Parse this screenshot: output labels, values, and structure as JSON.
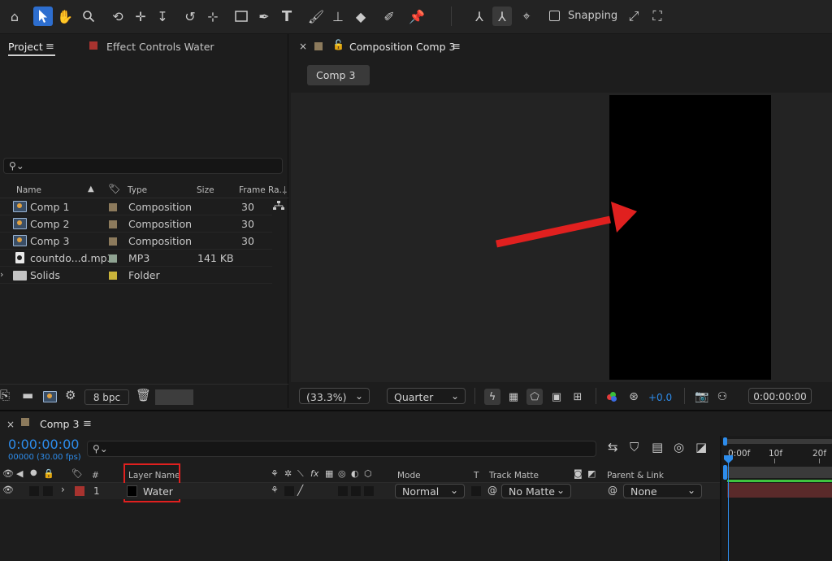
{
  "toolbar": {
    "tools": [
      "home-icon",
      "selection-arrow-icon",
      "hand-icon",
      "zoom-icon",
      "orbit-camera-icon",
      "pan-camera-icon",
      "dolly-camera-icon",
      "rotation-icon",
      "anchor-point-icon",
      "rectangle-icon",
      "pen-icon",
      "type-icon",
      "brush-icon",
      "clone-stamp-icon",
      "eraser-icon",
      "roto-brush-icon",
      "puppet-pin-icon"
    ],
    "snapping_label": "Snapping"
  },
  "project_panel": {
    "tab_project": "Project",
    "tab_effect_controls": "Effect Controls Water",
    "columns": {
      "name": "Name",
      "type": "Type",
      "size": "Size",
      "frame_rate": "Frame Ra..."
    },
    "items": [
      {
        "name": "Comp 1",
        "type": "Composition",
        "size": "",
        "frame_rate": "30",
        "label_color": "#8c7a5c",
        "icon": "composition-icon"
      },
      {
        "name": "Comp 2",
        "type": "Composition",
        "size": "",
        "frame_rate": "30",
        "label_color": "#8c7a5c",
        "icon": "composition-icon"
      },
      {
        "name": "Comp 3",
        "type": "Composition",
        "size": "",
        "frame_rate": "30",
        "label_color": "#8c7a5c",
        "icon": "composition-icon"
      },
      {
        "name": "countdo...d.mp3",
        "type": "MP3",
        "size": "141 KB",
        "frame_rate": "",
        "label_color": "#8fa392",
        "icon": "audio-file-icon"
      },
      {
        "name": "Solids",
        "type": "Folder",
        "size": "",
        "frame_rate": "",
        "label_color": "#c9b33a",
        "icon": "folder-icon"
      }
    ],
    "bpc_label": "8 bpc"
  },
  "comp_panel": {
    "title": "Composition Comp 3",
    "comp_tab": "Comp 3",
    "zoom_value": "(33.3%)",
    "resolution_value": "Quarter",
    "exposure_value": "+0.0",
    "timecode": "0:00:00:00"
  },
  "timeline": {
    "tab": "Comp 3",
    "current_time": "0:00:00:00",
    "frame_info": "00000 (30.00 fps)",
    "columns": {
      "number": "#",
      "layer_name": "Layer Name",
      "mode": "Mode",
      "t": "T",
      "track_matte": "Track Matte",
      "parent_link": "Parent & Link"
    },
    "layers": [
      {
        "number": "1",
        "name": "Water",
        "mode": "Normal",
        "track_matte": "No Matte",
        "parent": "None",
        "label_color": "#a8332f"
      }
    ],
    "ruler_labels": [
      "0:00f",
      "10f",
      "20f"
    ]
  },
  "colors": {
    "accent_blue": "#2d8ceb",
    "highlight_red": "#e0201f",
    "track_green": "#3fc43f",
    "layer_bar": "#5a2a2a"
  }
}
